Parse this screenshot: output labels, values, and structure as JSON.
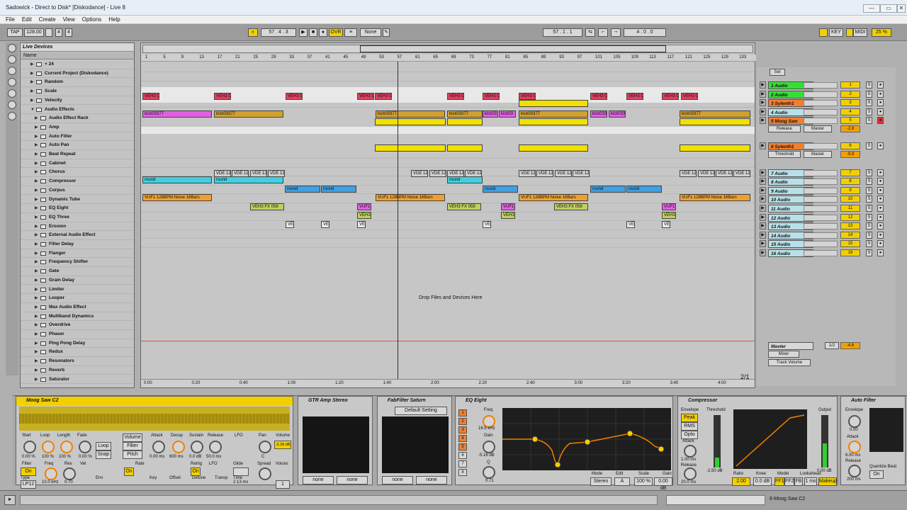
{
  "window": {
    "title": "Sadowick - Direct to Disk* [Diskodance] - Live 8",
    "minimize": "—",
    "maximize": "▭",
    "close": "✕"
  },
  "menu": [
    "File",
    "Edit",
    "Create",
    "View",
    "Options",
    "Help"
  ],
  "transport": {
    "tap": "TAP",
    "tempo": "128.00",
    "signature_num": "4",
    "signature_den": "4",
    "position": "57 . 4 . 3",
    "ovr": "OVR",
    "quantize": "None",
    "loop_start": "57 . 1 . 1",
    "loop_length": "4 . 0 . 0",
    "key": "KEY",
    "midi": "MIDI",
    "cpu": "25 %",
    "play_icon": "play-icon",
    "stop_icon": "stop-icon",
    "record_icon": "record-icon"
  },
  "browser": {
    "header": "Live Devices",
    "column": "Name",
    "items": [
      "+ 24",
      "Current Project (Diskodance)",
      "Random",
      "Scale",
      "Velocity",
      "Audio Effects",
      "Audio Effect Rack",
      "Amp",
      "Auto Filter",
      "Auto Pan",
      "Beat Repeat",
      "Cabinet",
      "Chorus",
      "Compressor",
      "Corpus",
      "Dynamic Tube",
      "EQ Eight",
      "EQ Three",
      "Erosion",
      "External Audio Effect",
      "Filter Delay",
      "Flanger",
      "Frequency Shifter",
      "Gate",
      "Grain Delay",
      "Limiter",
      "Looper",
      "Max Audio Effect",
      "Multiband Dynamics",
      "Overdrive",
      "Phaser",
      "Ping Pong Delay",
      "Redux",
      "Resonators",
      "Reverb",
      "Saturator"
    ]
  },
  "arrangement": {
    "drop_text": "Drop Files and Devices Here",
    "bar_numbers": [
      "1",
      "5",
      "9",
      "13",
      "17",
      "21",
      "25",
      "29",
      "33",
      "37",
      "41",
      "45",
      "49",
      "53",
      "57",
      "61",
      "65",
      "69",
      "73",
      "77",
      "81",
      "85",
      "89",
      "93",
      "97",
      "101",
      "105",
      "109",
      "113",
      "117",
      "121",
      "125",
      "129",
      "133"
    ],
    "time_labels": [
      "0:00",
      "0:20",
      "0:40",
      "1:00",
      "1:20",
      "1:40",
      "2:00",
      "2:20",
      "2:40",
      "3:00",
      "3:20",
      "3:40",
      "4:00"
    ],
    "page": "2/1"
  },
  "clips": {
    "veh3c": "VEH3 C",
    "kick": "kick03377",
    "vde": "VDE 12",
    "round": "round",
    "vuf": "VUF1 128BPM Noise 16Bars",
    "vuf_short": "VUF1",
    "vuf2": "VUF1 128BPM Noise 16Bars",
    "vehfx": "VEH3 FX 058",
    "veh3": "VEH3",
    "ve": "VE",
    "kick_short": "kick03",
    "kick_mid": "kick033"
  },
  "mixer": {
    "set": "Set",
    "tracks": [
      {
        "name": "1 Audio",
        "num": "1",
        "color": "#35e035"
      },
      {
        "name": "2 Audio",
        "num": "2",
        "color": "#35e035"
      },
      {
        "name": "3 Sylenth1",
        "num": "3",
        "color": "#f08030"
      },
      {
        "name": "4 Audio",
        "num": "4",
        "color": "#b8e0e8"
      },
      {
        "name": "5 Moog Saw",
        "num": "5",
        "color": "#f08030"
      },
      {
        "name": "6 Sylenth1",
        "num": "6",
        "color": "#f08030"
      },
      {
        "name": "7 Audio",
        "num": "7",
        "color": "#b8e0e8"
      },
      {
        "name": "8 Audio",
        "num": "8",
        "color": "#b8e0e8"
      },
      {
        "name": "9 Audio",
        "num": "9",
        "color": "#b8e0e8"
      },
      {
        "name": "10 Audio",
        "num": "10",
        "color": "#b8e0e8"
      },
      {
        "name": "11 Audio",
        "num": "11",
        "color": "#b8e0e8"
      },
      {
        "name": "12 Audio",
        "num": "12",
        "color": "#b8e0e8"
      },
      {
        "name": "13 Audio",
        "num": "13",
        "color": "#b8e0e8"
      },
      {
        "name": "14 Audio",
        "num": "14",
        "color": "#b8e0e8"
      },
      {
        "name": "15 Audio",
        "num": "15",
        "color": "#b8e0e8"
      },
      {
        "name": "16 Audio",
        "num": "16",
        "color": "#b8e0e8"
      }
    ],
    "auto": "Auto",
    "off": "Off",
    "release": "Release",
    "threshold": "Threshold",
    "master_out": "Master",
    "vol5": "-2.8",
    "vol6": "-9.9",
    "pan": "C",
    "pan6": "6L",
    "master": {
      "name": "Master",
      "mixer": "Mixer",
      "track_volume": "Track Volume",
      "ratio1": "1/2",
      "ratio2": "1/2",
      "vol": "-4.6",
      "num": "0"
    },
    "s": "S"
  },
  "devices": {
    "moog": {
      "title": "Moog Saw C2",
      "start": "Start",
      "loop": "Loop",
      "length": "Length",
      "fade": "Fade",
      "volume": "Volume",
      "filter": "Filter",
      "pitch": "Pitch",
      "attack": "Attack",
      "decay": "Decay",
      "sustain": "Sustain",
      "release": "Release",
      "lfo": "LFO",
      "pan": "Pan",
      "start_v": "0.00 %",
      "loop_v": "100 %",
      "length_v": "100 %",
      "fade_v": "0.00 %",
      "attack_v": "0.00 ms",
      "decay_v": "600 ms",
      "sustain_v": "0.0 dB",
      "release_v": "50.0 ms",
      "vol_v": "-3.38 dB",
      "pan_v": "C",
      "freq": "Freq",
      "res": "Res",
      "vel": "Vel",
      "on": "On",
      "type": "Type",
      "type_v": "LP12",
      "freq_v": "10.0 kHz",
      "res_v": "0.70",
      "key": "Key",
      "env": "Env",
      "glide": "Glide",
      "spread": "Spread",
      "voices": "Voices",
      "voices_v": "1",
      "loop_btn": "Loop",
      "snap": "Snap",
      "rate": "Rate",
      "retrig": "Retrig",
      "transp": "Transp",
      "detune": "Detune",
      "time": "Time",
      "time_v": "2.13 ms",
      "offset": "Offset"
    },
    "gtr": {
      "title": "GTR Amp Stereo",
      "none1": "none",
      "none2": "none"
    },
    "fab": {
      "title": "FabFilter Saturn",
      "preset": "Default Setting",
      "none1": "none",
      "none2": "none"
    },
    "eq": {
      "title": "EQ Eight",
      "freq": "Freq",
      "freq_v": "16.5 kHz",
      "gain": "Gain",
      "gain_v": "-5.16 dB",
      "q": "Q",
      "q_v": "0.71",
      "mode": "Mode",
      "mode_v": "Stereo",
      "edit": "Edit",
      "edit_v": "A",
      "scale": "Scale",
      "scale_v": "100 %",
      "gain2": "Gain",
      "gain2_v": "0.00 dB",
      "bands": [
        "1",
        "2",
        "3",
        "4",
        "5",
        "6",
        "7",
        "8"
      ]
    },
    "comp": {
      "title": "Compressor",
      "envelope": "Envelope",
      "peak": "Peak",
      "rms": "RMS",
      "opto": "Opto",
      "threshold": "Threshold",
      "thr_v": "-2.50 dB",
      "output": "Output",
      "out_v": "0.00 dB",
      "attack": "Attack",
      "att_v": "1.00 ms",
      "release": "Release",
      "rel_v": "20.0 ms",
      "ratio": "Ratio",
      "ratio_v": "2.00",
      "knee": "Knee",
      "knee_v": "0.0 dB",
      "model": "Model",
      "ff1": "FF1",
      "ff2": "FF2",
      "fb": "FB",
      "lookahead": "Lookahead",
      "look_v": "1 ms",
      "makeup": "Makeup"
    },
    "auto": {
      "title": "Auto Filter",
      "envelope": "Envelope",
      "env_v": "0.00",
      "attack": "Attack",
      "att_v": "6.00 ms",
      "release": "Release",
      "rel_v": "200 ms",
      "quantize": "Quantize Beat",
      "on": "On"
    }
  },
  "status": {
    "track": "6-Moog Saw C2"
  },
  "colors": {
    "accent": "#f2d000",
    "clip_red": "#e04060",
    "clip_kick_pink": "#e060e0",
    "clip_kick_gold": "#d0a030",
    "clip_round": "#40d0e0",
    "clip_orange": "#f0a030",
    "clip_green": "#c0d060"
  }
}
